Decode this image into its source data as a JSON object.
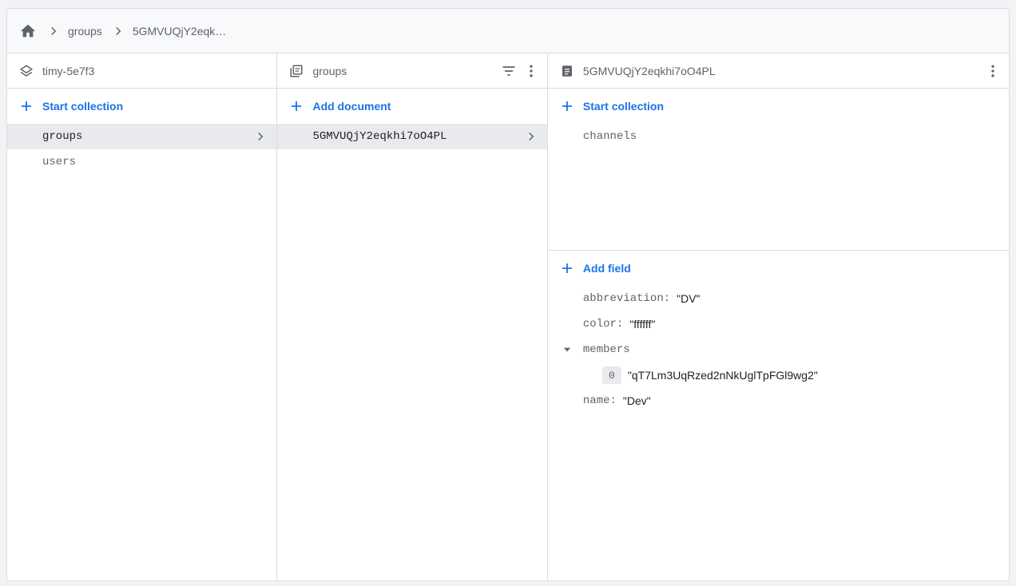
{
  "breadcrumb": {
    "items": [
      "groups",
      "5GMVUQjY2eqk…"
    ]
  },
  "project_column": {
    "title": "timy-5e7f3",
    "action": "Start collection",
    "collections": [
      {
        "label": "groups",
        "selected": true
      },
      {
        "label": "users",
        "selected": false
      }
    ]
  },
  "collection_column": {
    "title": "groups",
    "action": "Add document",
    "documents": [
      {
        "label": "5GMVUQjY2eqkhi7oO4PL",
        "selected": true
      }
    ]
  },
  "document_column": {
    "title": "5GMVUQjY2eqkhi7oO4PL",
    "subcollection_action": "Start collection",
    "subcollections": [
      "channels"
    ],
    "field_action": "Add field",
    "fields": {
      "abbreviation": {
        "key": "abbreviation:",
        "value": "\"DV\""
      },
      "color": {
        "key": "color:",
        "value": "\"ffffff\""
      },
      "members": {
        "key": "members",
        "items": [
          {
            "index": "0",
            "value": "\"qT7Lm3UqRzed2nNkUglTpFGl9wg2\""
          }
        ]
      },
      "name": {
        "key": "name:",
        "value": "\"Dev\""
      }
    }
  },
  "colors": {
    "accent": "#1a73e8",
    "selected_bg": "#e8eaed",
    "border": "#dadce0",
    "icon": "#5f6368"
  }
}
